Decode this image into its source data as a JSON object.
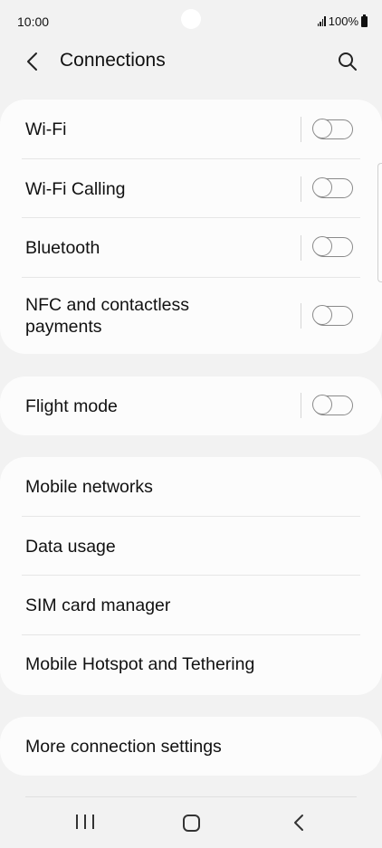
{
  "status_bar": {
    "time": "10:00",
    "battery": "100%",
    "icons": [
      "signal-icon",
      "battery-icon"
    ]
  },
  "header": {
    "title": "Connections",
    "back_icon": "chevron-left-icon",
    "search_icon": "search-icon"
  },
  "groups": [
    {
      "items": [
        {
          "label": "Wi-Fi",
          "toggle": false
        },
        {
          "label": "Wi-Fi Calling",
          "toggle": false
        },
        {
          "label": "Bluetooth",
          "toggle": false
        },
        {
          "label": "NFC and contactless payments",
          "toggle": false
        }
      ]
    },
    {
      "items": [
        {
          "label": "Flight mode",
          "toggle": false
        }
      ]
    },
    {
      "items": [
        {
          "label": "Mobile networks"
        },
        {
          "label": "Data usage"
        },
        {
          "label": "SIM card manager"
        },
        {
          "label": "Mobile Hotspot and Tethering"
        }
      ]
    },
    {
      "items": [
        {
          "label": "More connection settings"
        }
      ]
    }
  ],
  "nav_bar": {
    "icons": [
      "recent-apps-icon",
      "home-icon",
      "back-icon"
    ]
  },
  "colors": {
    "background": "#f2f2f2",
    "card": "#fcfcfc",
    "toggle_off_outline": "#8a8a8a"
  }
}
